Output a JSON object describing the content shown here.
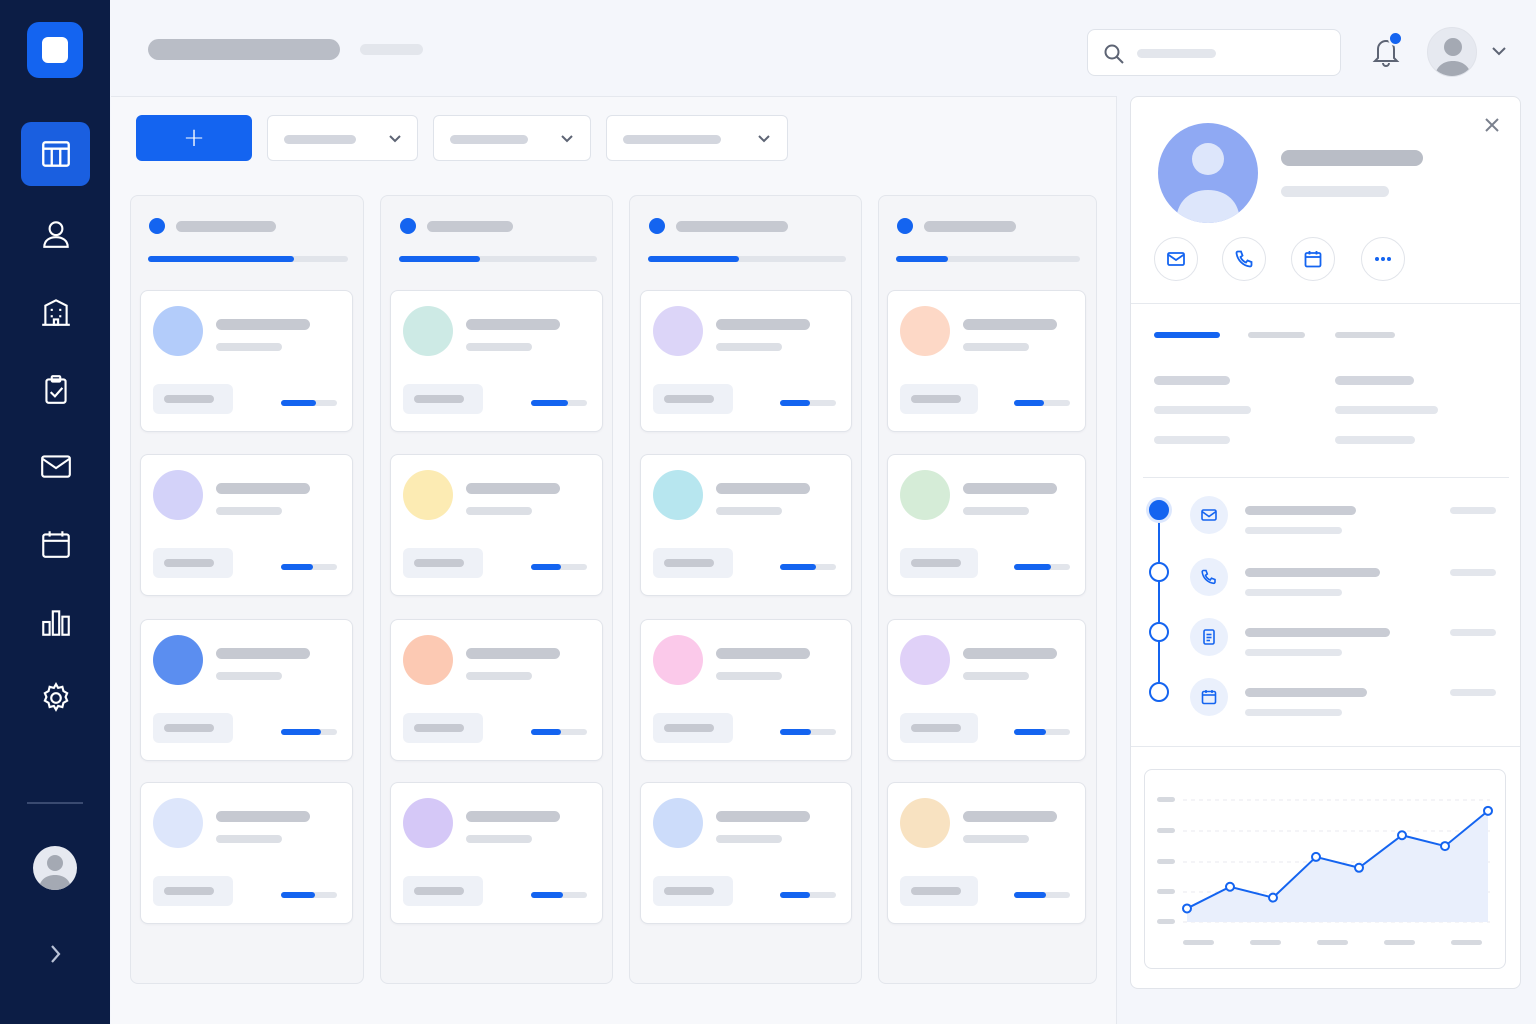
{
  "app": {
    "accent_color": "#1464f0",
    "sidebar_color": "#0c1d45"
  },
  "sidebar": {
    "items": [
      {
        "icon": "board-icon",
        "active": true
      },
      {
        "icon": "user-icon",
        "active": false
      },
      {
        "icon": "building-icon",
        "active": false
      },
      {
        "icon": "clipboard-check-icon",
        "active": false
      },
      {
        "icon": "mail-icon",
        "active": false
      },
      {
        "icon": "calendar-icon",
        "active": false
      },
      {
        "icon": "bar-chart-icon",
        "active": false
      },
      {
        "icon": "gear-icon",
        "active": false
      }
    ],
    "expand_icon": "chevron-right-icon"
  },
  "header": {
    "search_value": "",
    "notification_badge": true
  },
  "toolbar": {
    "add_label": "+"
  },
  "board": {
    "columns": [
      {
        "progress": 0.73,
        "cards": [
          {
            "color": "#b3ccfa",
            "progress": 0.63
          },
          {
            "color": "#d3d2f9",
            "progress": 0.58
          },
          {
            "color": "#5b8ef0",
            "progress": 0.71
          },
          {
            "color": "#dde6fb",
            "progress": 0.6
          }
        ]
      },
      {
        "progress": 0.41,
        "cards": [
          {
            "color": "#cdeae5",
            "progress": 0.66
          },
          {
            "color": "#fcebb3",
            "progress": 0.53
          },
          {
            "color": "#fcc9b3",
            "progress": 0.54
          },
          {
            "color": "#d5c8f7",
            "progress": 0.57
          }
        ]
      },
      {
        "progress": 0.46,
        "cards": [
          {
            "color": "#dcd5f8",
            "progress": 0.53
          },
          {
            "color": "#b7e6ef",
            "progress": 0.64
          },
          {
            "color": "#fbc9ea",
            "progress": 0.56
          },
          {
            "color": "#ccdcfa",
            "progress": 0.53
          }
        ]
      },
      {
        "progress": 0.28,
        "cards": [
          {
            "color": "#fdd8c6",
            "progress": 0.54
          },
          {
            "color": "#d5ecd7",
            "progress": 0.66
          },
          {
            "color": "#e0d1f8",
            "progress": 0.57
          },
          {
            "color": "#f8e2c1",
            "progress": 0.57
          }
        ]
      }
    ]
  },
  "panel": {
    "actions": [
      "mail-icon",
      "phone-icon",
      "calendar-icon",
      "more-icon"
    ],
    "timeline": [
      {
        "icon": "mail-icon",
        "done": true
      },
      {
        "icon": "phone-icon",
        "done": false
      },
      {
        "icon": "document-icon",
        "done": false
      },
      {
        "icon": "calendar-icon",
        "done": false
      }
    ],
    "chart_data": {
      "type": "line",
      "x": [
        1,
        2,
        3,
        4,
        5,
        6,
        7,
        8
      ],
      "series": [
        {
          "values": [
            0.5,
            1.3,
            0.9,
            2.4,
            2.0,
            3.2,
            2.8,
            4.1
          ]
        }
      ],
      "ylim": [
        0,
        4.5
      ],
      "grid": true,
      "fill": true
    }
  }
}
